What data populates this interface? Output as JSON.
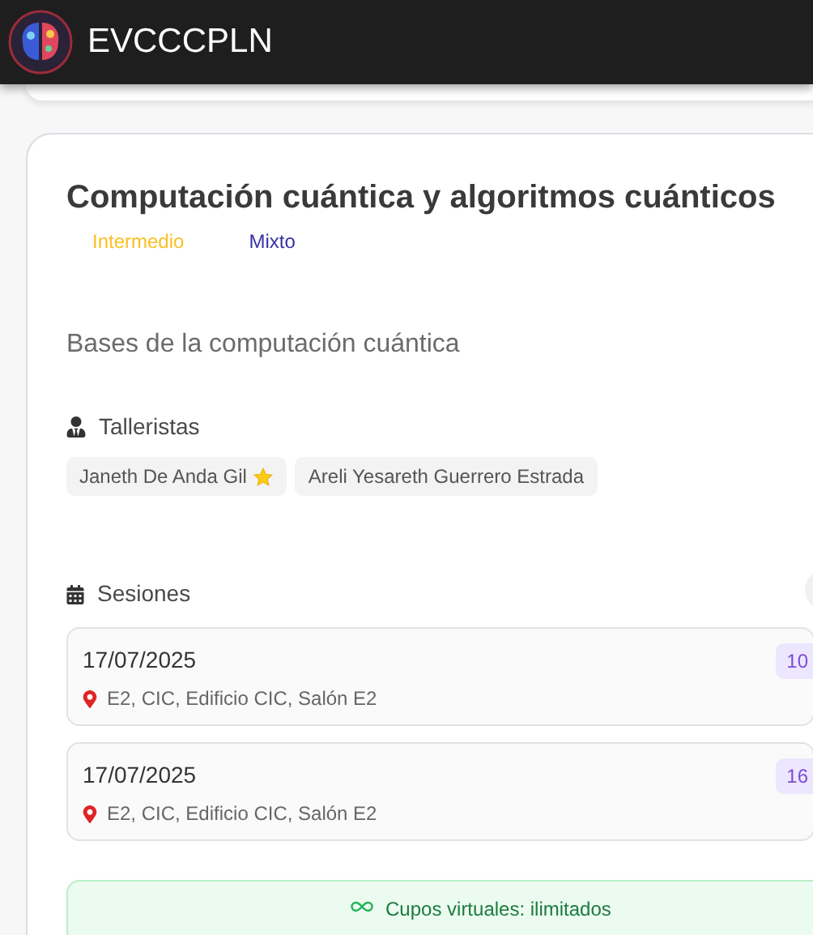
{
  "header": {
    "title": "EVCCCPLN"
  },
  "workshop": {
    "title": "Computación cuántica y algoritmos cuánticos",
    "tags": [
      {
        "label": "Intermedio",
        "color": "#fbbf24"
      },
      {
        "label": "Mixto",
        "color": "#3730a3"
      }
    ],
    "description": "Bases de la computación cuántica",
    "instructors_heading": "Talleristas",
    "instructors": [
      {
        "name": "Janeth De Anda Gil",
        "starred": true
      },
      {
        "name": "Areli Yesareth Guerrero Estrada",
        "starred": false
      }
    ],
    "sessions_heading": "Sesiones",
    "sessions": [
      {
        "date": "17/07/2025",
        "location": "E2, CIC, Edificio CIC, Salón E2",
        "time": "10"
      },
      {
        "date": "17/07/2025",
        "location": "E2, CIC, Edificio CIC, Salón E2",
        "time": "16"
      }
    ],
    "virtual_seats": "Cupos virtuales: ilimitados"
  }
}
